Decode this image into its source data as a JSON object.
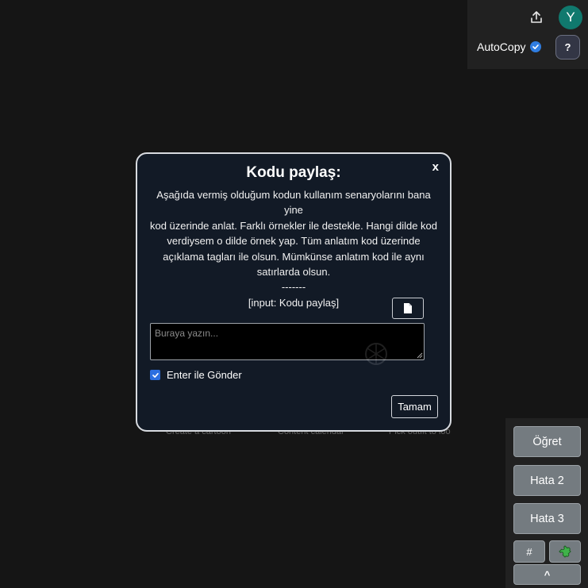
{
  "header": {
    "avatar_initial": "Y",
    "autocopy_label": "AutoCopy",
    "help_label": "?"
  },
  "background_suggestions": [
    "Create a cartoon",
    "Content calendar",
    "Pick outfit to loo"
  ],
  "modal": {
    "title": "Kodu paylaş:",
    "close_label": "x",
    "body_lines": [
      "Aşağıda vermiş olduğum kodun kullanım senaryolarını bana yine",
      "kod üzerinde anlat. Farklı örnekler ile destekle. Hangi dilde kod",
      "verdiysem o dilde örnek yap. Tüm anlatım kod üzerinde",
      "açıklama tagları ile olsun. Mümkünse anlatım kod ile aynı",
      "satırlarda olsun."
    ],
    "separator": "-------",
    "input_tag": "[input: Kodu paylaş]",
    "textarea_placeholder": "Buraya yazın...",
    "textarea_value": "",
    "enter_send_label": "Enter ile Gönder",
    "enter_send_checked": true,
    "ok_label": "Tamam"
  },
  "side_panel": {
    "buttons": [
      "Öğret",
      "Hata 2",
      "Hata 3"
    ],
    "hash_label": "#",
    "caret_label": "^"
  },
  "colors": {
    "page_bg": "#151515",
    "modal_bg": "#121a26",
    "accent_blue": "#2c6fe0",
    "avatar_bg": "#10796e",
    "side_button_bg": "#747b80"
  }
}
